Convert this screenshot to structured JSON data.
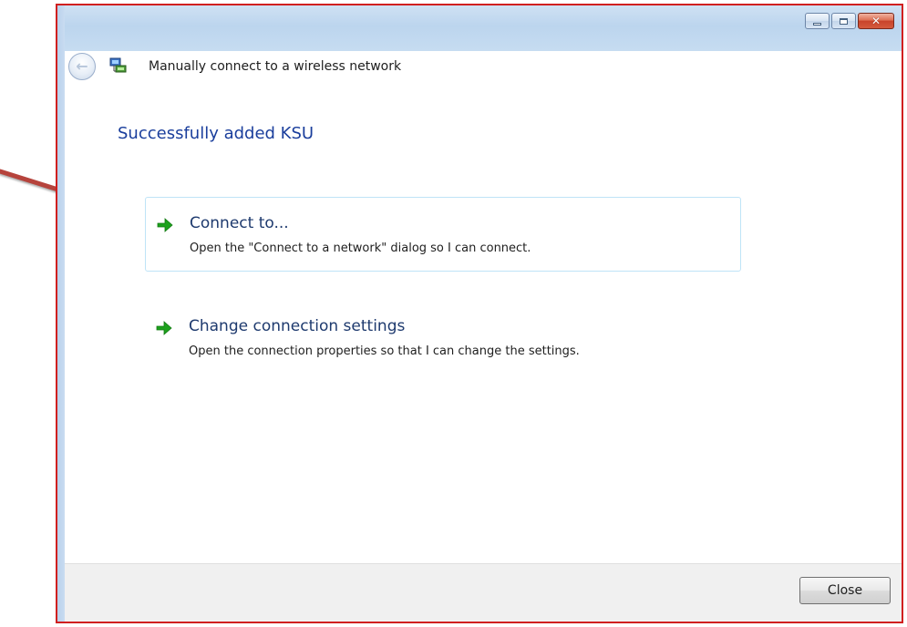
{
  "window": {
    "title": "Manually connect to a wireless network",
    "controls": [
      "minimize",
      "maximize",
      "close"
    ]
  },
  "heading": "Successfully added KSU",
  "tasks": [
    {
      "title": "Connect to...",
      "description": "Open the \"Connect to a network\" dialog so I can connect.",
      "icon": "green-arrow-icon",
      "highlighted": true
    },
    {
      "title": "Change connection settings",
      "description": "Open the connection properties so that I can change the settings.",
      "icon": "green-arrow-icon",
      "highlighted": false
    }
  ],
  "footer": {
    "close_label": "Close"
  },
  "colors": {
    "annotation_frame": "#d01f1f",
    "annotation_arrow": "#b6433c",
    "heading": "#1a3e9c",
    "task_arrow": "#1da11d",
    "hover_border": "#bfe4f7"
  },
  "icons": {
    "back": "back-arrow-icon",
    "network": "network-icon"
  }
}
